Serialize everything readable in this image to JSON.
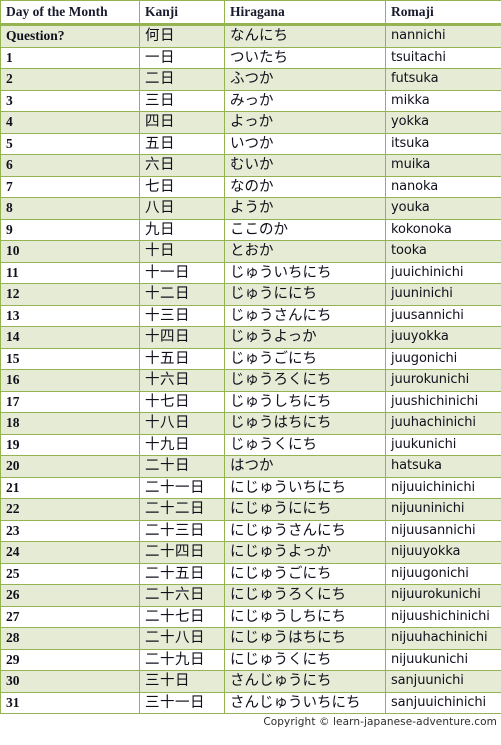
{
  "table": {
    "columns": [
      {
        "key": "day",
        "label": "Day of the Month"
      },
      {
        "key": "kanji",
        "label": "Kanji"
      },
      {
        "key": "hira",
        "label": "Hiragana"
      },
      {
        "key": "romaji",
        "label": "Romaji"
      }
    ],
    "rows": [
      {
        "day": "Question?",
        "kanji": "何日",
        "hira": "なんにち",
        "romaji": "nannichi",
        "shaded": true,
        "question": true
      },
      {
        "day": "1",
        "kanji": "一日",
        "hira": "ついたち",
        "romaji": "tsuitachi",
        "shaded": false
      },
      {
        "day": "2",
        "kanji": "二日",
        "hira": "ふつか",
        "romaji": "futsuka",
        "shaded": true
      },
      {
        "day": "3",
        "kanji": "三日",
        "hira": "みっか",
        "romaji": "mikka",
        "shaded": false
      },
      {
        "day": "4",
        "kanji": "四日",
        "hira": "よっか",
        "romaji": "yokka",
        "shaded": true
      },
      {
        "day": "5",
        "kanji": "五日",
        "hira": "いつか",
        "romaji": "itsuka",
        "shaded": false
      },
      {
        "day": "6",
        "kanji": "六日",
        "hira": "むいか",
        "romaji": "muika",
        "shaded": true
      },
      {
        "day": "7",
        "kanji": "七日",
        "hira": "なのか",
        "romaji": "nanoka",
        "shaded": false
      },
      {
        "day": "8",
        "kanji": "八日",
        "hira": "ようか",
        "romaji": "youka",
        "shaded": true
      },
      {
        "day": "9",
        "kanji": "九日",
        "hira": "ここのか",
        "romaji": "kokonoka",
        "shaded": false
      },
      {
        "day": "10",
        "kanji": "十日",
        "hira": "とおか",
        "romaji": "tooka",
        "shaded": true
      },
      {
        "day": "11",
        "kanji": "十一日",
        "hira": "じゅういちにち",
        "romaji": "juuichinichi",
        "shaded": false
      },
      {
        "day": "12",
        "kanji": "十二日",
        "hira": "じゅうににち",
        "romaji": "juuninichi",
        "shaded": true
      },
      {
        "day": "13",
        "kanji": "十三日",
        "hira": "じゅうさんにち",
        "romaji": "juusannichi",
        "shaded": false
      },
      {
        "day": "14",
        "kanji": "十四日",
        "hira": "じゅうよっか",
        "romaji": "juuyokka",
        "shaded": true
      },
      {
        "day": "15",
        "kanji": "十五日",
        "hira": "じゅうごにち",
        "romaji": "juugonichi",
        "shaded": false
      },
      {
        "day": "16",
        "kanji": "十六日",
        "hira": "じゅうろくにち",
        "romaji": "juurokunichi",
        "shaded": true
      },
      {
        "day": "17",
        "kanji": "十七日",
        "hira": "じゅうしちにち",
        "romaji": "juushichinichi",
        "shaded": false
      },
      {
        "day": "18",
        "kanji": "十八日",
        "hira": "じゅうはちにち",
        "romaji": "juuhachinichi",
        "shaded": true
      },
      {
        "day": "19",
        "kanji": "十九日",
        "hira": "じゅうくにち",
        "romaji": "juukunichi",
        "shaded": false
      },
      {
        "day": "20",
        "kanji": "二十日",
        "hira": "はつか",
        "romaji": "hatsuka",
        "shaded": true
      },
      {
        "day": "21",
        "kanji": "二十一日",
        "hira": "にじゅういちにち",
        "romaji": "nijuuichinichi",
        "shaded": false
      },
      {
        "day": "22",
        "kanji": "二十二日",
        "hira": "にじゅうににち",
        "romaji": "nijuuninichi",
        "shaded": true
      },
      {
        "day": "23",
        "kanji": "二十三日",
        "hira": "にじゅうさんにち",
        "romaji": "nijuusannichi",
        "shaded": false
      },
      {
        "day": "24",
        "kanji": "二十四日",
        "hira": "にじゅうよっか",
        "romaji": "nijuuyokka",
        "shaded": true
      },
      {
        "day": "25",
        "kanji": "二十五日",
        "hira": "にじゅうごにち",
        "romaji": "nijuugonichi",
        "shaded": false
      },
      {
        "day": "26",
        "kanji": "二十六日",
        "hira": "にじゅうろくにち",
        "romaji": "nijuurokunichi",
        "shaded": true
      },
      {
        "day": "27",
        "kanji": "二十七日",
        "hira": "にじゅうしちにち",
        "romaji": "nijuushichinichi",
        "shaded": false
      },
      {
        "day": "28",
        "kanji": "二十八日",
        "hira": "にじゅうはちにち",
        "romaji": "nijuuhachinichi",
        "shaded": true
      },
      {
        "day": "29",
        "kanji": "二十九日",
        "hira": "にじゅうくにち",
        "romaji": "nijuukunichi",
        "shaded": false
      },
      {
        "day": "30",
        "kanji": "三十日",
        "hira": "さんじゅうにち",
        "romaji": "sanjuunichi",
        "shaded": true
      },
      {
        "day": "31",
        "kanji": "三十一日",
        "hira": "さんじゅういちにち",
        "romaji": "sanjuuichinichi",
        "shaded": false
      }
    ]
  },
  "footer": {
    "copyright": "Copyright © learn-japanese-adventure.com"
  },
  "colors": {
    "border_green": "#93b451",
    "row_shaded": "#e5ebd4",
    "row_plain": "#ffffff",
    "text_dark": "#14142a"
  }
}
